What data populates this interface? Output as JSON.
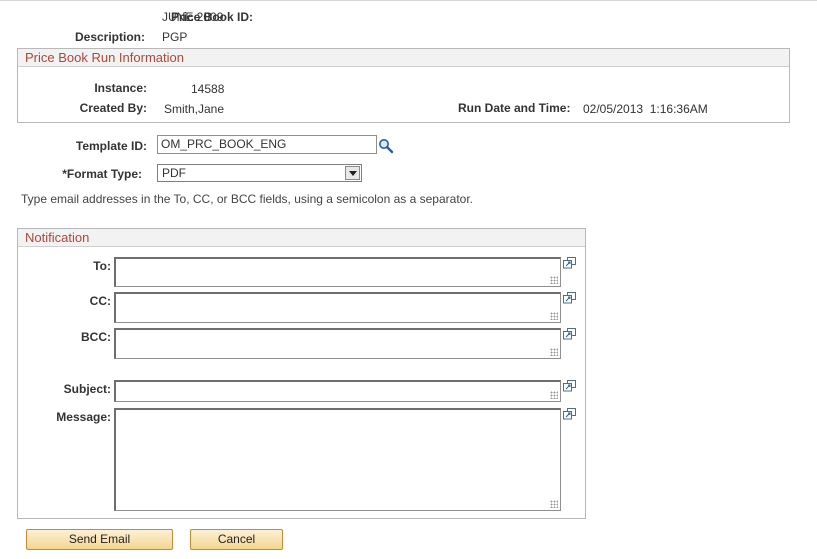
{
  "header": {
    "price_book_id_label": "Price Book ID:",
    "price_book_id_value": "JUNE 2009",
    "description_label": "Description:",
    "description_value": "PGP"
  },
  "run_info": {
    "title": "Price Book Run Information",
    "instance_label": "Instance:",
    "instance_value": "14588",
    "created_by_label": "Created By:",
    "created_by_value": "Smith,Jane",
    "run_date_label": "Run Date and Time:",
    "run_date_value": "02/05/2013  1:16:36AM"
  },
  "form": {
    "template_label": "Template ID:",
    "template_value": "OM_PRC_BOOK_ENG",
    "format_label": "*Format Type:",
    "format_value": "PDF",
    "instructions": "Type email addresses in the To, CC, or BCC fields, using a semicolon as a separator."
  },
  "notification": {
    "title": "Notification",
    "to_label": "To:",
    "cc_label": "CC:",
    "bcc_label": "BCC:",
    "subject_label": "Subject:",
    "message_label": "Message:",
    "to_value": "",
    "cc_value": "",
    "bcc_value": "",
    "subject_value": "",
    "message_value": ""
  },
  "buttons": {
    "send_label": "Send Email",
    "cancel_label": "Cancel"
  },
  "icons": {
    "lookup": "magnifier-icon",
    "expand": "expand-field-icon"
  },
  "colors": {
    "group_title": "#b0473a",
    "button_fill": "#f4d58f",
    "button_border": "#c48a35"
  }
}
